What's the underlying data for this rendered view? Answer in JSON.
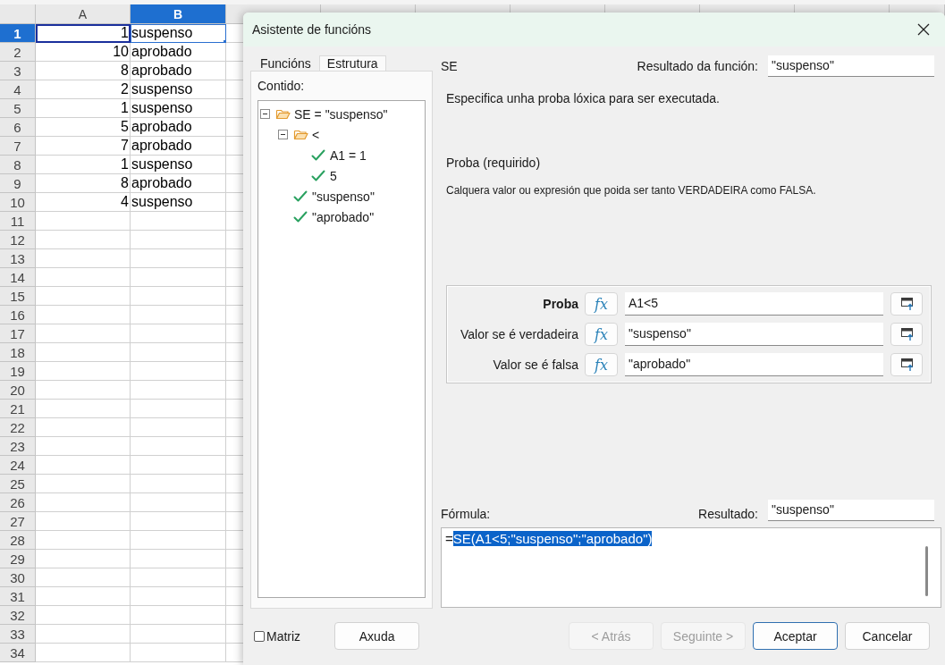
{
  "spreadsheet": {
    "columns": [
      {
        "label": "A",
        "selected": false
      },
      {
        "label": "B",
        "selected": true
      }
    ],
    "rows": [
      {
        "label": "1",
        "selected": true,
        "cells": [
          {
            "text": "1",
            "highlighted": true,
            "active": false
          },
          {
            "text": "suspenso",
            "highlighted": false,
            "active": true
          }
        ]
      },
      {
        "label": "2",
        "selected": false,
        "cells": [
          {
            "text": "10",
            "highlighted": false,
            "active": false
          },
          {
            "text": "aprobado",
            "highlighted": false,
            "active": false
          }
        ]
      },
      {
        "label": "3",
        "selected": false,
        "cells": [
          {
            "text": "8",
            "highlighted": false,
            "active": false
          },
          {
            "text": "aprobado",
            "highlighted": false,
            "active": false
          }
        ]
      },
      {
        "label": "4",
        "selected": false,
        "cells": [
          {
            "text": "2",
            "highlighted": false,
            "active": false
          },
          {
            "text": "suspenso",
            "highlighted": false,
            "active": false
          }
        ]
      },
      {
        "label": "5",
        "selected": false,
        "cells": [
          {
            "text": "1",
            "highlighted": false,
            "active": false
          },
          {
            "text": "suspenso",
            "highlighted": false,
            "active": false
          }
        ]
      },
      {
        "label": "6",
        "selected": false,
        "cells": [
          {
            "text": "5",
            "highlighted": false,
            "active": false
          },
          {
            "text": "aprobado",
            "highlighted": false,
            "active": false
          }
        ]
      },
      {
        "label": "7",
        "selected": false,
        "cells": [
          {
            "text": "7",
            "highlighted": false,
            "active": false
          },
          {
            "text": "aprobado",
            "highlighted": false,
            "active": false
          }
        ]
      },
      {
        "label": "8",
        "selected": false,
        "cells": [
          {
            "text": "1",
            "highlighted": false,
            "active": false
          },
          {
            "text": "suspenso",
            "highlighted": false,
            "active": false
          }
        ]
      },
      {
        "label": "9",
        "selected": false,
        "cells": [
          {
            "text": "8",
            "highlighted": false,
            "active": false
          },
          {
            "text": "aprobado",
            "highlighted": false,
            "active": false
          }
        ]
      },
      {
        "label": "10",
        "selected": false,
        "cells": [
          {
            "text": "4",
            "highlighted": false,
            "active": false
          },
          {
            "text": "suspenso",
            "highlighted": false,
            "active": false
          }
        ]
      },
      {
        "label": "11",
        "selected": false
      },
      {
        "label": "12",
        "selected": false
      },
      {
        "label": "13",
        "selected": false
      },
      {
        "label": "14",
        "selected": false
      },
      {
        "label": "15",
        "selected": false
      },
      {
        "label": "16",
        "selected": false
      },
      {
        "label": "17",
        "selected": false
      },
      {
        "label": "18",
        "selected": false
      },
      {
        "label": "19",
        "selected": false
      },
      {
        "label": "20",
        "selected": false
      },
      {
        "label": "21",
        "selected": false
      },
      {
        "label": "22",
        "selected": false
      },
      {
        "label": "23",
        "selected": false
      },
      {
        "label": "24",
        "selected": false
      },
      {
        "label": "25",
        "selected": false
      },
      {
        "label": "26",
        "selected": false
      },
      {
        "label": "27",
        "selected": false
      },
      {
        "label": "28",
        "selected": false
      },
      {
        "label": "29",
        "selected": false
      },
      {
        "label": "30",
        "selected": false
      },
      {
        "label": "31",
        "selected": false
      },
      {
        "label": "32",
        "selected": false
      },
      {
        "label": "33",
        "selected": false
      },
      {
        "label": "34",
        "selected": false
      }
    ]
  },
  "dialog": {
    "title": "Asistente de funcións",
    "tabs": [
      {
        "label": "Funcións",
        "selected": false
      },
      {
        "label": "Estrutura",
        "selected": true
      }
    ],
    "contents_label": "Contido:",
    "tree": [
      {
        "label": "SE = \"suspenso\"",
        "kind": "folder",
        "expanded": true,
        "children": [
          {
            "label": "<",
            "kind": "folder",
            "expanded": true,
            "children": [
              {
                "label": "A1 = 1",
                "kind": "value"
              },
              {
                "label": "5",
                "kind": "value"
              }
            ]
          },
          {
            "label": "\"suspenso\"",
            "kind": "value"
          },
          {
            "label": "\"aprobado\"",
            "kind": "value"
          }
        ]
      }
    ],
    "function_name": "SE",
    "function_result": {
      "label": "Resultado da función:",
      "value": "\"suspenso\""
    },
    "description": "Especifica unha proba lóxica para ser executada.",
    "argument_title": "Proba (requirido)",
    "argument_help": "Calquera valor ou expresión que poida ser tanto VERDADEIRA como FALSA.",
    "arguments": [
      {
        "label": "Proba",
        "selected": true,
        "fx": "fx",
        "value": "A1<5"
      },
      {
        "label": "Valor se é verdadeira",
        "selected": false,
        "fx": "fx",
        "value": "\"suspenso\""
      },
      {
        "label": "Valor se é falsa",
        "selected": false,
        "fx": "fx",
        "value": "\"aprobado\""
      }
    ],
    "formula": {
      "label": "Fórmula:",
      "parts": [
        {
          "text": "=",
          "selected": false
        },
        {
          "text": "SE(A1<5;\"suspenso\";\"aprobado\")",
          "selected": true
        }
      ]
    },
    "result": {
      "label": "Resultado:",
      "value": "\"suspenso\""
    },
    "matrix": {
      "label": "Matriz",
      "checked": false
    },
    "help_button": "Axuda",
    "buttons": [
      {
        "label": "< Atrás",
        "disabled": true,
        "focused": false
      },
      {
        "label": "Seguinte >",
        "disabled": true,
        "focused": false
      },
      {
        "label": "Aceptar",
        "disabled": false,
        "focused": true
      },
      {
        "label": "Cancelar",
        "disabled": false,
        "focused": false
      }
    ]
  }
}
